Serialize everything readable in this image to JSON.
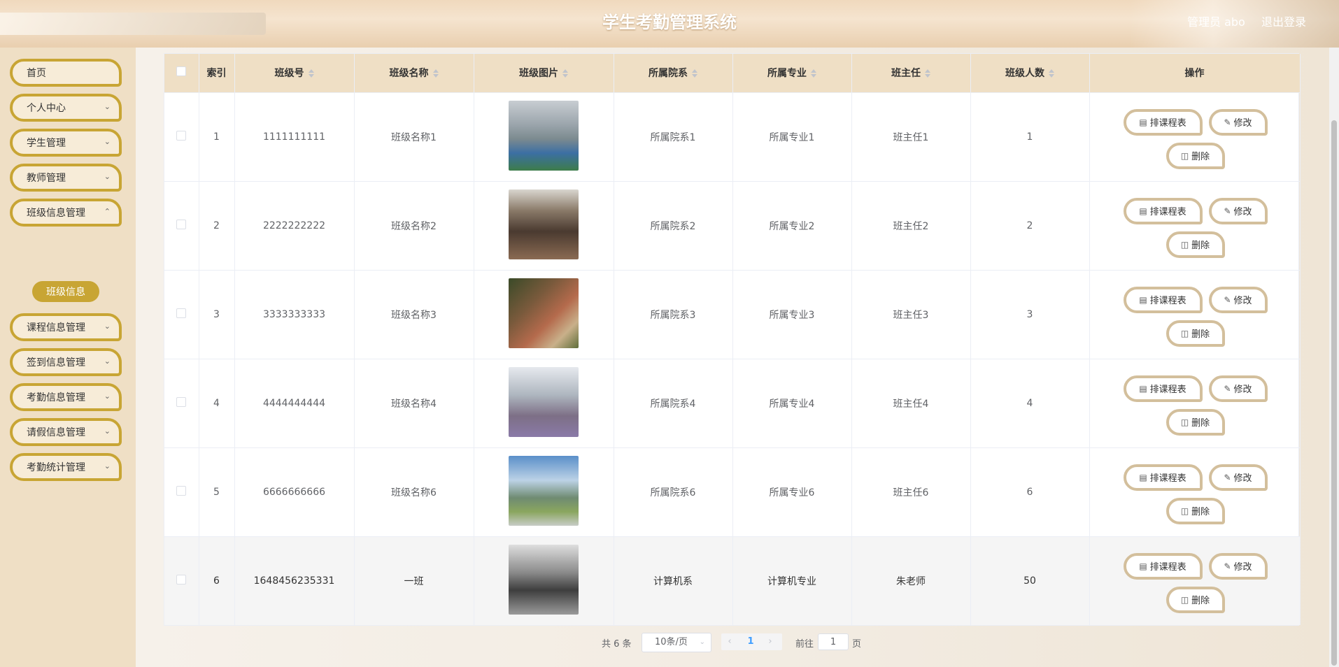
{
  "header": {
    "title": "学生考勤管理系统",
    "user": "管理员 abo",
    "logout": "退出登录"
  },
  "sidebar": {
    "items": [
      {
        "label": "首页",
        "has_children": false
      },
      {
        "label": "个人中心",
        "has_children": true
      },
      {
        "label": "学生管理",
        "has_children": true
      },
      {
        "label": "教师管理",
        "has_children": true
      },
      {
        "label": "班级信息管理",
        "has_children": true,
        "expanded": true
      },
      {
        "label": "课程信息管理",
        "has_children": true
      },
      {
        "label": "签到信息管理",
        "has_children": true
      },
      {
        "label": "考勤信息管理",
        "has_children": true
      },
      {
        "label": "请假信息管理",
        "has_children": true
      },
      {
        "label": "考勤统计管理",
        "has_children": true
      }
    ],
    "active_sub": "班级信息"
  },
  "table": {
    "columns": [
      "索引",
      "班级号",
      "班级名称",
      "班级图片",
      "所属院系",
      "所属专业",
      "班主任",
      "班级人数",
      "操作"
    ],
    "rows": [
      {
        "index": "1",
        "class_no": "1111111111",
        "class_name": "班级名称1",
        "department": "所属院系1",
        "major": "所属专业1",
        "head_teacher": "班主任1",
        "count": "1"
      },
      {
        "index": "2",
        "class_no": "2222222222",
        "class_name": "班级名称2",
        "department": "所属院系2",
        "major": "所属专业2",
        "head_teacher": "班主任2",
        "count": "2"
      },
      {
        "index": "3",
        "class_no": "3333333333",
        "class_name": "班级名称3",
        "department": "所属院系3",
        "major": "所属专业3",
        "head_teacher": "班主任3",
        "count": "3"
      },
      {
        "index": "4",
        "class_no": "4444444444",
        "class_name": "班级名称4",
        "department": "所属院系4",
        "major": "所属专业4",
        "head_teacher": "班主任4",
        "count": "4"
      },
      {
        "index": "5",
        "class_no": "6666666666",
        "class_name": "班级名称6",
        "department": "所属院系6",
        "major": "所属专业6",
        "head_teacher": "班主任6",
        "count": "6"
      },
      {
        "index": "6",
        "class_no": "1648456235331",
        "class_name": "一班",
        "department": "计算机系",
        "major": "计算机专业",
        "head_teacher": "朱老师",
        "count": "50"
      }
    ],
    "actions": {
      "schedule": "排课程表",
      "edit": "修改",
      "delete": "删除"
    }
  },
  "pagination": {
    "total": "共 6 条",
    "page_size": "10条/页",
    "current_page": "1",
    "goto_label": "前往",
    "goto_value": "1",
    "page_unit": "页"
  },
  "icons": {
    "chevron": "chevron-down-icon",
    "schedule": "document-icon",
    "edit": "pencil-icon",
    "delete": "trash-icon"
  }
}
